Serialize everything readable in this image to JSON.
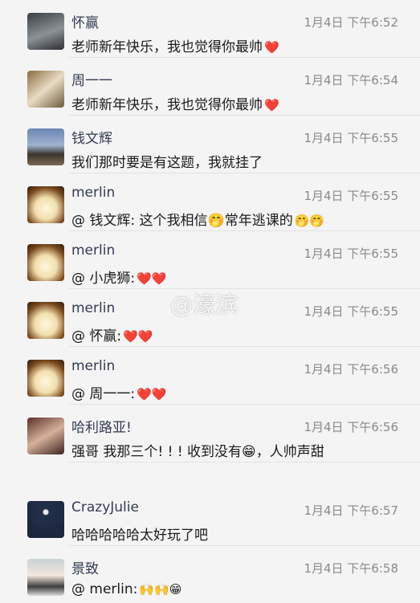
{
  "messages": [
    {
      "name": "怀赢",
      "time": "1月4日 下午6:52",
      "text": "老师新年快乐，我也觉得你最帅",
      "emoji": "❤️"
    },
    {
      "name": "周一一",
      "time": "1月4日 下午6:54",
      "text": "老师新年快乐，我也觉得你最帅",
      "emoji": "❤️"
    },
    {
      "name": "钱文辉",
      "time": "1月4日 下午6:55",
      "text": "我们那时要是有这题，我就挂了",
      "emoji": ""
    },
    {
      "name": "merlin",
      "time": "1月4日 下午6:55",
      "text": "@ 钱文辉: 这个我相信🤭常年逃课的",
      "emoji": "🤭🤭"
    },
    {
      "name": "merlin",
      "time": "1月4日 下午6:55",
      "text": "@ 小虎狮:",
      "emoji": "❤️❤️"
    },
    {
      "name": "merlin",
      "time": "1月4日 下午6:55",
      "text": "@ 怀赢:",
      "emoji": "❤️❤️"
    },
    {
      "name": "merlin",
      "time": "1月4日 下午6:56",
      "text": "@ 周一一:",
      "emoji": "❤️❤️"
    },
    {
      "name": "哈利路亚!",
      "time": "1月4日 下午6:56",
      "text": "强哥 我那三个! ! ! 收到没有😁，人帅声甜",
      "emoji": ""
    },
    {
      "name": "CrazyJulie",
      "time": "1月4日 下午6:57",
      "text": "哈哈哈哈哈太好玩了吧",
      "emoji": ""
    },
    {
      "name": "景致",
      "time": "1月4日 下午6:58",
      "text": "@ merlin:",
      "emoji": "🙌🙌😁"
    }
  ],
  "watermark": "@濠滨"
}
